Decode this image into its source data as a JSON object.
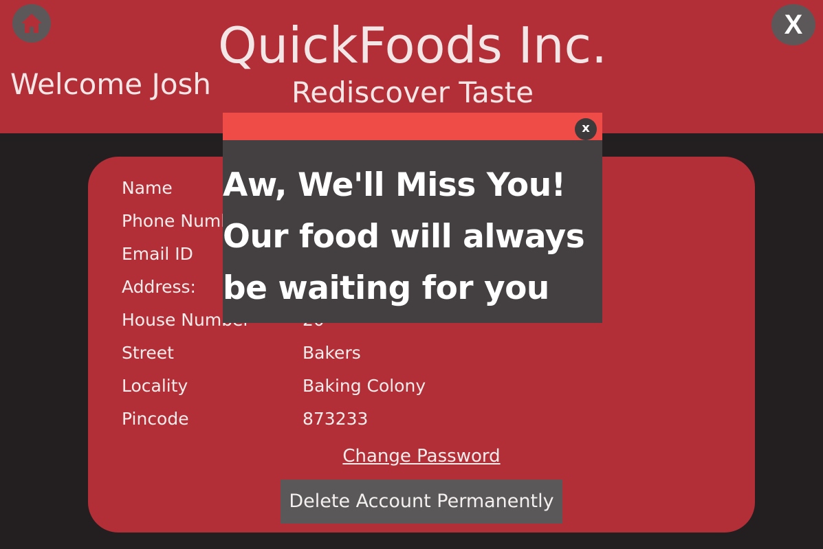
{
  "header": {
    "brand": "QuickFoods Inc.",
    "tagline": "Rediscover Taste",
    "welcome": "Welcome Josh",
    "home_icon": "home-icon",
    "close_label": "X",
    "background_color": "#b32f38"
  },
  "profile": {
    "fields": [
      {
        "label": "Name",
        "value": ""
      },
      {
        "label": "Phone Number",
        "value": ""
      },
      {
        "label": "Email ID",
        "value": ""
      },
      {
        "label": "Address:",
        "value": ""
      },
      {
        "label": "House Number",
        "value": "20"
      },
      {
        "label": "Street",
        "value": "Bakers"
      },
      {
        "label": "Locality",
        "value": "Baking Colony"
      },
      {
        "label": "Pincode",
        "value": "873233"
      }
    ],
    "change_password": "Change Password",
    "delete_account": "Delete Account Permanently"
  },
  "popup": {
    "close_label": "x",
    "line1": "Aw, We'll Miss You!",
    "line2": "Our food will always",
    "line3": "be waiting for you",
    "bar_color": "#ef4b47"
  }
}
